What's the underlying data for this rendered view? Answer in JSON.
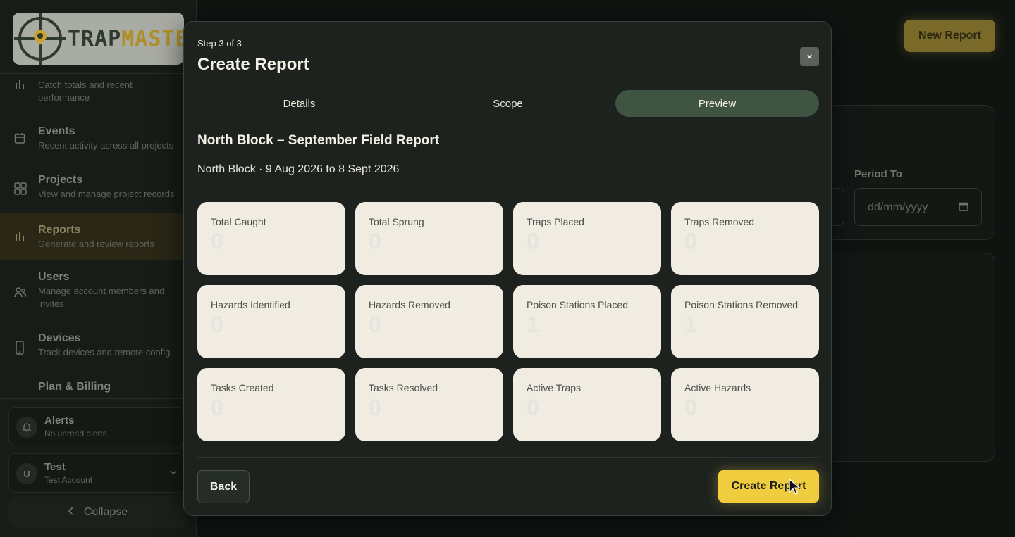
{
  "app": {
    "logo": {
      "word_main": "TRAP",
      "word_accent": "MASTER"
    }
  },
  "sidebar": {
    "items": [
      {
        "title": "",
        "subtitle": "Catch totals and recent performance",
        "icon": "bar-chart-icon"
      },
      {
        "title": "Events",
        "subtitle": "Recent activity across all projects",
        "icon": "calendar-icon"
      },
      {
        "title": "Projects",
        "subtitle": "View and manage project records",
        "icon": "grid-icon"
      },
      {
        "title": "Reports",
        "subtitle": "Generate and review reports",
        "icon": "bar-chart-icon",
        "active": true
      },
      {
        "title": "Users",
        "subtitle": "Manage account members and invites",
        "icon": "users-icon"
      },
      {
        "title": "Devices",
        "subtitle": "Track devices and remote config",
        "icon": "phone-icon"
      },
      {
        "title": "Plan & Billing",
        "subtitle": "",
        "icon": "card-icon"
      }
    ],
    "alerts": {
      "title": "Alerts",
      "subtitle": "No unread alerts",
      "icon": "bell-icon"
    },
    "user": {
      "initial": "U",
      "name": "Test",
      "account": "Test Account"
    },
    "collapse_label": "Collapse"
  },
  "page": {
    "new_report_label": "New Report",
    "period_to_label": "Period To",
    "date_placeholder": "dd/mm/yyyy"
  },
  "modal": {
    "step": "Step 3 of 3",
    "title": "Create Report",
    "close_label": "×",
    "tabs": [
      {
        "label": "Details"
      },
      {
        "label": "Scope"
      },
      {
        "label": "Preview",
        "active": true
      }
    ],
    "report_title": "North Block – September Field Report",
    "report_subtitle": "North Block · 9 Aug 2026 to 8 Sept 2026",
    "stats": [
      {
        "label": "Total Caught",
        "value": "0"
      },
      {
        "label": "Total Sprung",
        "value": "0"
      },
      {
        "label": "Traps Placed",
        "value": "0"
      },
      {
        "label": "Traps Removed",
        "value": "0"
      },
      {
        "label": "Hazards Identified",
        "value": "0"
      },
      {
        "label": "Hazards Removed",
        "value": "0"
      },
      {
        "label": "Poison Stations Placed",
        "value": "1"
      },
      {
        "label": "Poison Stations Removed",
        "value": "1"
      },
      {
        "label": "Tasks Created",
        "value": "0"
      },
      {
        "label": "Tasks Resolved",
        "value": "0"
      },
      {
        "label": "Active Traps",
        "value": "0"
      },
      {
        "label": "Active Hazards",
        "value": "0"
      }
    ],
    "back_label": "Back",
    "create_label": "Create Report"
  },
  "colors": {
    "accent": "#f0cd3f",
    "active_tab": "#3f5443",
    "card_bg": "#f1ece1"
  }
}
